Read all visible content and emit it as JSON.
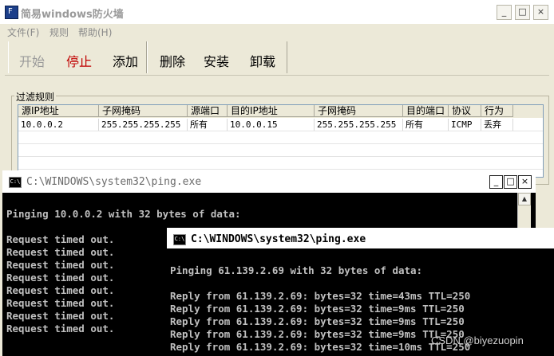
{
  "main_window": {
    "title": "简易windows防火墙",
    "title_buttons": {
      "minimize": "_",
      "maximize": "□",
      "close": "×"
    },
    "menu": [
      "文件(F)",
      "规则",
      "帮助(H)"
    ],
    "toolbar": {
      "start": "开始",
      "stop": "停止",
      "add": "添加",
      "delete": "删除",
      "install": "安装",
      "uninstall": "卸载"
    },
    "filter_group_label": "过滤规则",
    "columns": [
      "源IP地址",
      "子网掩码",
      "源端口",
      "目的IP地址",
      "子网掩码",
      "目的端口",
      "协议",
      "行为"
    ],
    "rows": [
      [
        "10.0.0.2",
        "255.255.255.255",
        "所有",
        "10.0.0.15",
        "255.255.255.255",
        "所有",
        "ICMP",
        "丢弃"
      ]
    ]
  },
  "console_back": {
    "title": "C:\\WINDOWS\\system32\\ping.exe",
    "buttons": {
      "minimize": "_",
      "maximize": "□",
      "close": "×"
    },
    "lines": [
      "Pinging 10.0.0.2 with 32 bytes of data:",
      "",
      "Request timed out.",
      "Request timed out.",
      "Request timed out.",
      "Request timed out.",
      "Request timed out.",
      "Request timed out.",
      "Request timed out.",
      "Request timed out."
    ]
  },
  "console_front": {
    "title": "C:\\WINDOWS\\system32\\ping.exe",
    "lines": [
      "Pinging 61.139.2.69 with 32 bytes of data:",
      "",
      "Reply from 61.139.2.69: bytes=32 time=43ms TTL=250",
      "Reply from 61.139.2.69: bytes=32 time=9ms TTL=250",
      "Reply from 61.139.2.69: bytes=32 time=9ms TTL=250",
      "Reply from 61.139.2.69: bytes=32 time=9ms TTL=250",
      "Reply from 61.139.2.69: bytes=32 time=10ms TTL=250"
    ]
  },
  "watermark": "CSDN @biyezuopin",
  "colors": {
    "stop_button": "#c00000",
    "disabled_text": "#8a8a8a",
    "console_text": "#c0c0c0"
  }
}
